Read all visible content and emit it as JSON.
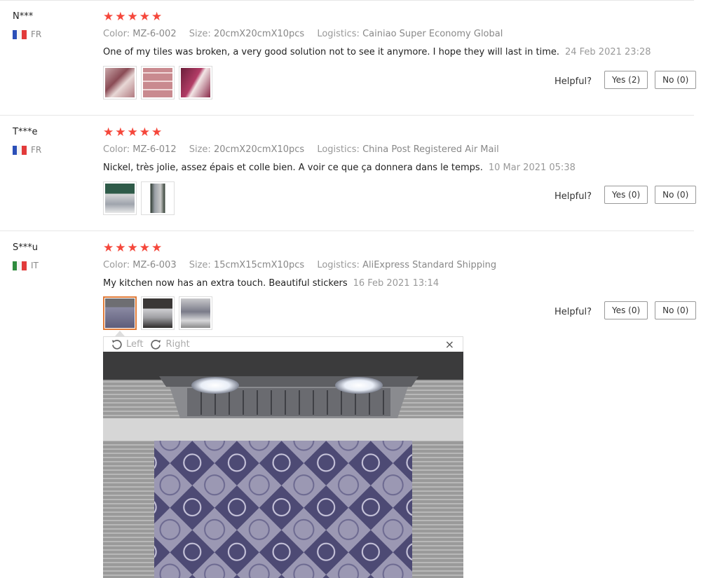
{
  "reviews": [
    {
      "user": "N***",
      "country": "FR",
      "flag": "fr",
      "rating": 5,
      "color_label": "Color:",
      "color": "MZ-6-002",
      "size_label": "Size:",
      "size": "20cmX20cmX10pcs",
      "logistics_label": "Logistics:",
      "logistics": "Cainiao Super Economy Global",
      "text": "One of my tiles was broken, a very good solution not to see it anymore. I hope they will last in time.",
      "date": "24 Feb 2021 23:28",
      "helpful_label": "Helpful?",
      "yes": "Yes (2)",
      "no": "No (0)"
    },
    {
      "user": "T***e",
      "country": "FR",
      "flag": "fr",
      "rating": 5,
      "color_label": "Color:",
      "color": "MZ-6-012",
      "size_label": "Size:",
      "size": "20cmX20cmX10pcs",
      "logistics_label": "Logistics:",
      "logistics": "China Post Registered Air Mail",
      "text": "Nickel, très jolie, assez épais et colle bien. A voir ce que ça donnera dans le temps.",
      "date": "10 Mar 2021 05:38",
      "helpful_label": "Helpful?",
      "yes": "Yes (0)",
      "no": "No (0)"
    },
    {
      "user": "S***u",
      "country": "IT",
      "flag": "it",
      "rating": 5,
      "color_label": "Color:",
      "color": "MZ-6-003",
      "size_label": "Size:",
      "size": "15cmX15cmX10pcs",
      "logistics_label": "Logistics:",
      "logistics": "AliExpress Standard Shipping",
      "text": "My kitchen now has an extra touch. Beautiful stickers",
      "date": "16 Feb 2021 13:14",
      "helpful_label": "Helpful?",
      "yes": "Yes (0)",
      "no": "No (0)"
    }
  ],
  "viewer": {
    "rotate_left": "Left",
    "rotate_right": "Right",
    "close": "×"
  },
  "colors": {
    "star": "#f5473b",
    "active_thumb_border": "#e07b39"
  }
}
